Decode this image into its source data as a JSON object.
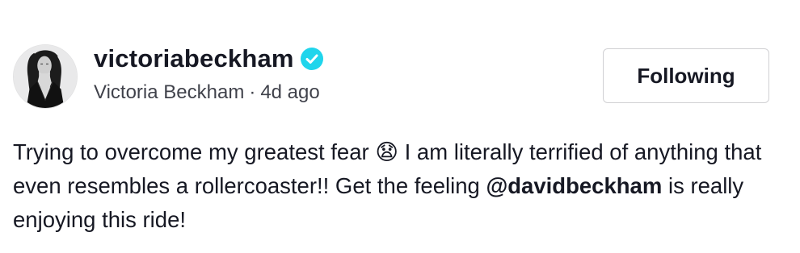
{
  "author": {
    "username": "victoriabeckham",
    "display_name": "Victoria Beckham",
    "separator": "·",
    "time_ago": "4d ago",
    "verified_icon": "verified-badge-icon",
    "verified_color": "#20d5ec"
  },
  "follow_button": {
    "label": "Following"
  },
  "caption": {
    "text_before_emoji": "Trying to overcome my greatest fear ",
    "emoji": "😧",
    "text_after_emoji": " I am literally terrified of anything that even resembles a rollercoaster!! Get the feeling ",
    "mention": "@davidbeckham",
    "text_after_mention": " is really enjoying this ride!"
  }
}
